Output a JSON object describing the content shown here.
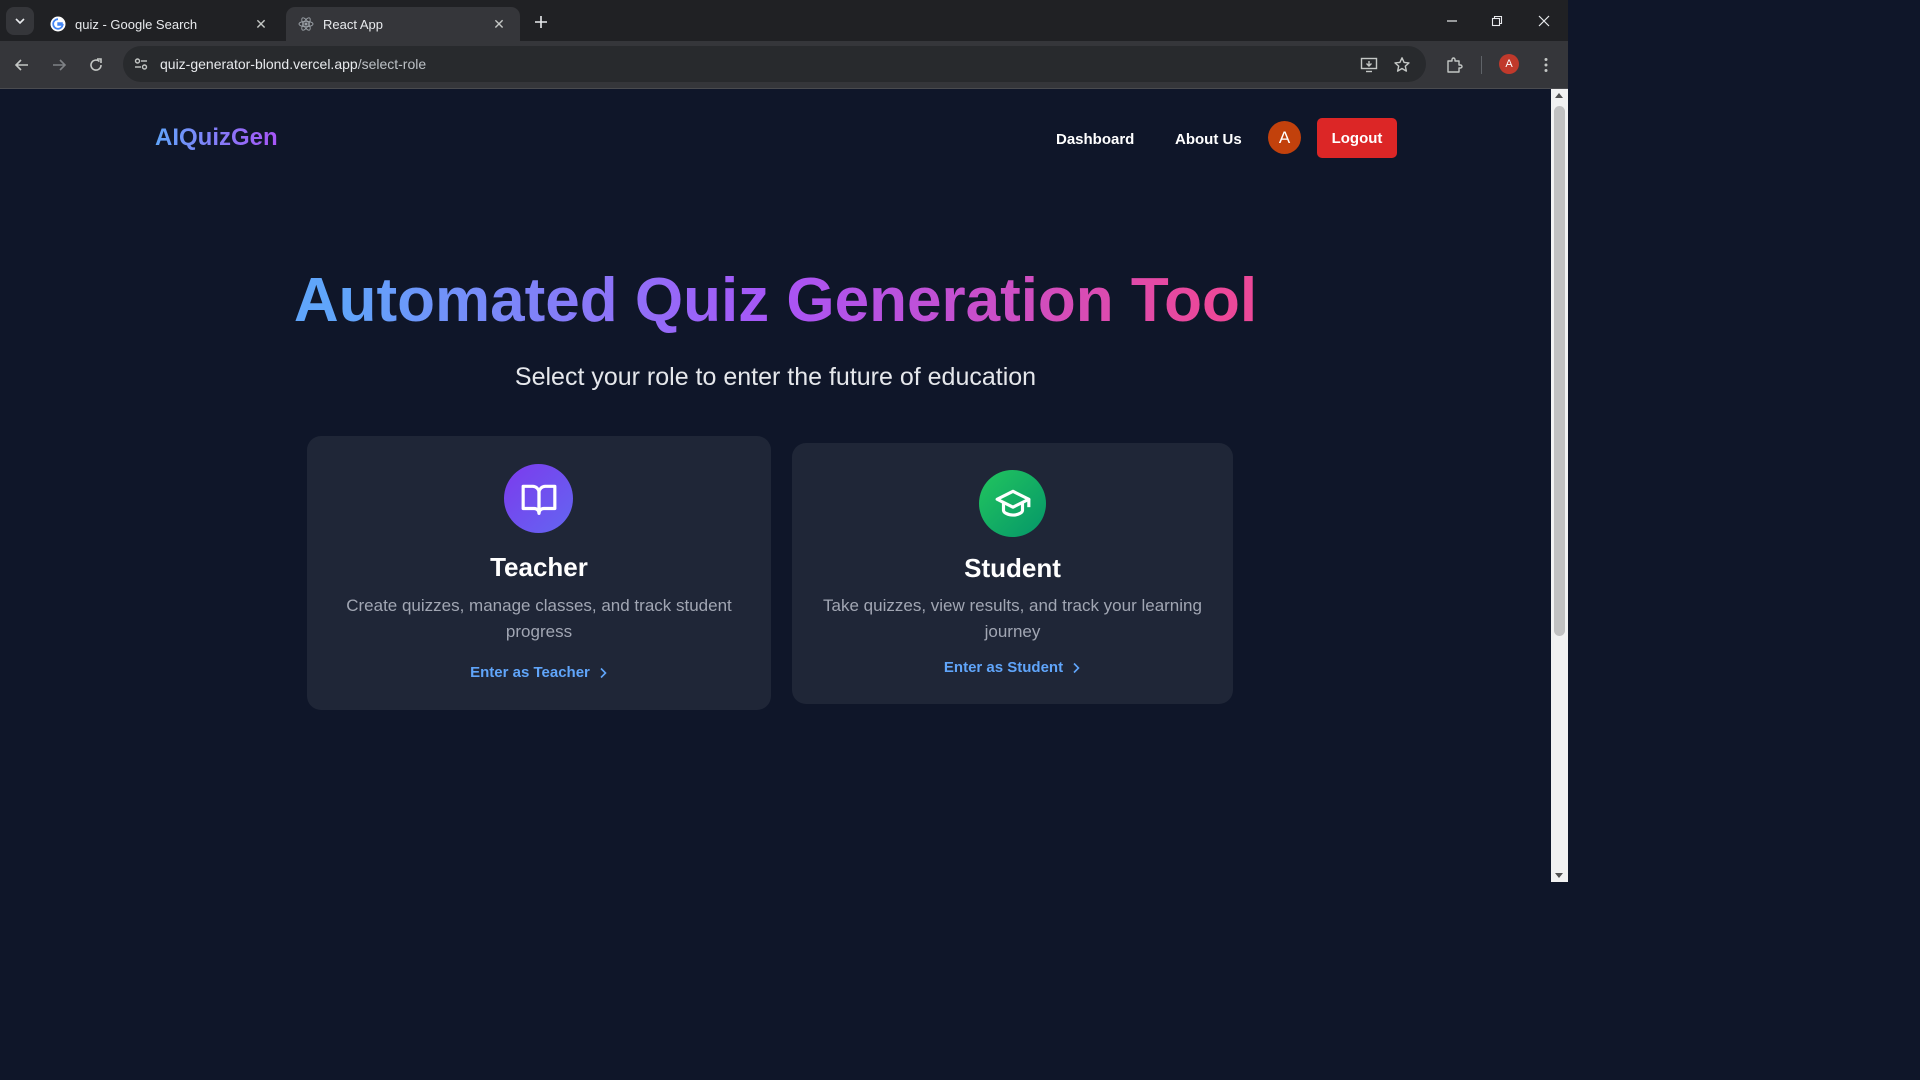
{
  "browser": {
    "tabs": [
      {
        "title": "quiz - Google Search",
        "favicon": "google-icon",
        "active": false
      },
      {
        "title": "React App",
        "favicon": "react-icon",
        "active": true
      }
    ],
    "url_host": "quiz-generator-blond.vercel.app",
    "url_path": "/select-role",
    "profile_initial": "A"
  },
  "header": {
    "logo": "AIQuizGen",
    "nav": [
      {
        "label": "Dashboard"
      },
      {
        "label": "About Us"
      }
    ],
    "avatar_initial": "A",
    "logout_label": "Logout"
  },
  "hero": {
    "title": "Automated Quiz Generation Tool",
    "subtitle": "Select your role to enter the future of education"
  },
  "roles": [
    {
      "icon": "book-open-icon",
      "title": "Teacher",
      "description": "Create quizzes, manage classes, and track student progress",
      "link": "Enter as Teacher"
    },
    {
      "icon": "graduation-cap-icon",
      "title": "Student",
      "description": "Take quizzes, view results, and track your learning journey",
      "link": "Enter as Student"
    }
  ],
  "colors": {
    "page_bg": "#0f1629",
    "card_bg": "#1f2637",
    "link": "#60a5fa",
    "logout": "#dc2626",
    "teacher_icon": "#7c3aed",
    "student_icon": "#22c55e"
  }
}
